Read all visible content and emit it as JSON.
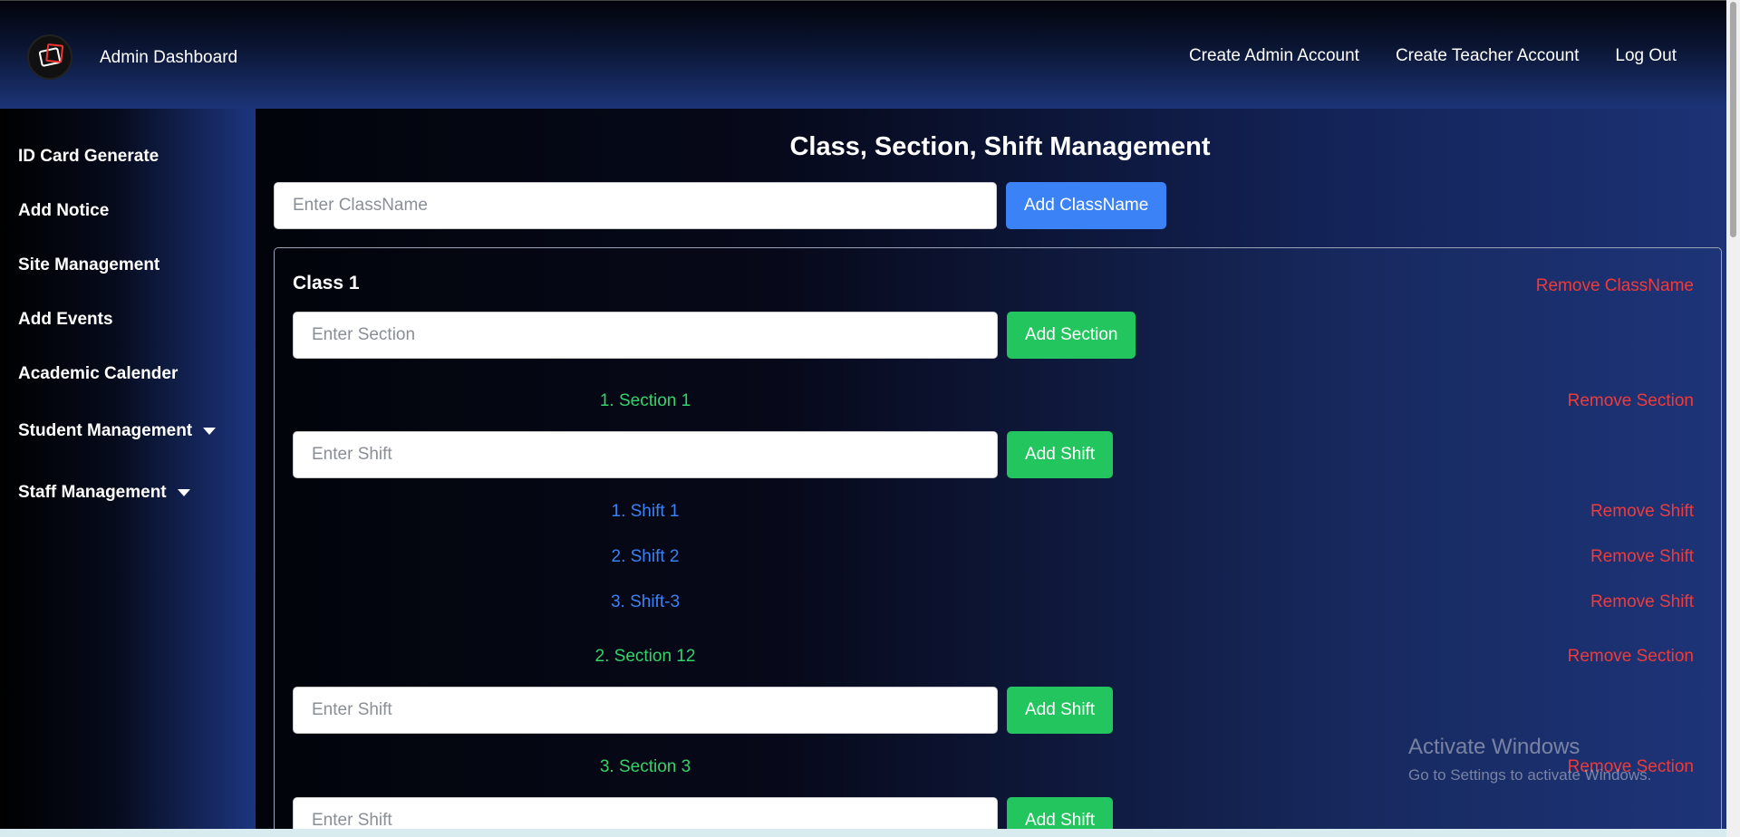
{
  "navbar": {
    "brand": "Admin Dashboard",
    "links": [
      "Create Admin Account",
      "Create Teacher Account",
      "Log Out"
    ]
  },
  "sidebar": {
    "items": [
      {
        "label": "ID Card Generate"
      },
      {
        "label": "Add Notice"
      },
      {
        "label": "Site Management"
      },
      {
        "label": "Add Events"
      },
      {
        "label": "Academic Calender"
      },
      {
        "label": "Student Management"
      },
      {
        "label": "Staff Management"
      }
    ]
  },
  "main": {
    "title": "Class, Section, Shift Management",
    "class_input_placeholder": "Enter ClassName",
    "add_class_label": "Add ClassName",
    "class": {
      "name": "Class 1",
      "remove_label": "Remove ClassName",
      "section_input_placeholder": "Enter Section",
      "add_section_label": "Add Section",
      "sections": [
        {
          "label": "1. Section 1",
          "remove_label": "Remove Section",
          "shift_input_placeholder": "Enter Shift",
          "add_shift_label": "Add Shift",
          "shifts": [
            {
              "label": "1. Shift 1",
              "remove_label": "Remove Shift"
            },
            {
              "label": "2. Shift 2",
              "remove_label": "Remove Shift"
            },
            {
              "label": "3. Shift-3",
              "remove_label": "Remove Shift"
            }
          ]
        },
        {
          "label": "2. Section 12",
          "remove_label": "Remove Section",
          "shift_input_placeholder": "Enter Shift",
          "add_shift_label": "Add Shift"
        },
        {
          "label": "3. Section 3",
          "remove_label": "Remove Section",
          "shift_input_placeholder": "Enter Shift",
          "add_shift_label": "Add Shift"
        }
      ]
    }
  },
  "watermark": {
    "line1": "Activate Windows",
    "line2": "Go to Settings to activate Windows."
  },
  "colors": {
    "accent_blue": "#3b82f6",
    "success_green": "#22c55e",
    "danger_red": "#ef3b3b"
  }
}
